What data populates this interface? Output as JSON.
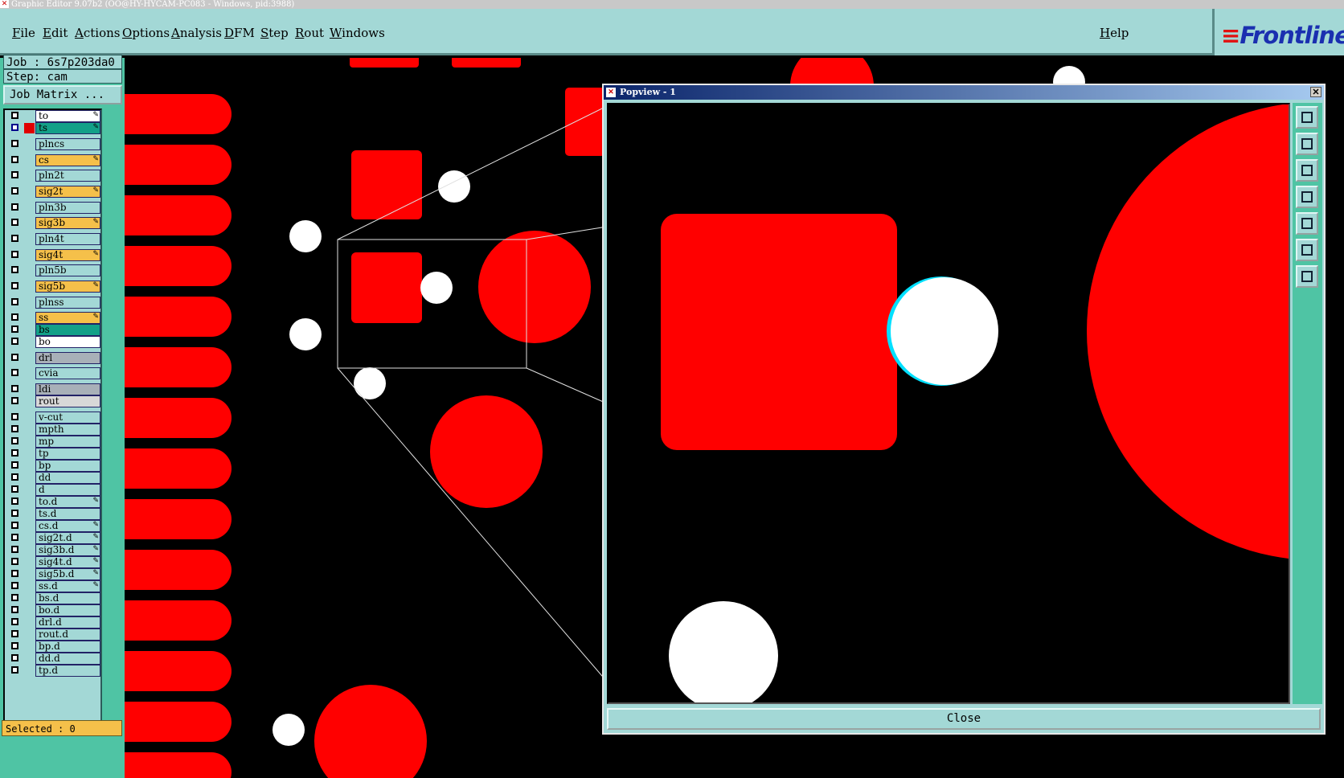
{
  "window": {
    "title": "Graphic Editor 9.07b2 (OO@HY-HYCAM-PC083 - Windows, pid:3988)"
  },
  "menu": [
    "File",
    "Edit",
    "Actions",
    "Options",
    "Analysis",
    "DFM",
    "Step",
    "Rout",
    "Windows"
  ],
  "help": "Help",
  "logo": {
    "text": "Frontline",
    "icon": "frontline-logo-icon"
  },
  "job": {
    "label": "Job : 6s7p203da0"
  },
  "step": {
    "label": "Step: cam"
  },
  "job_matrix": "Job Matrix ...",
  "layers": [
    {
      "name": "to",
      "color": "#ffffff",
      "edit": true
    },
    {
      "name": "ts",
      "color": "#13a088",
      "edit": true,
      "active": true
    },
    {
      "name": "plncs",
      "color": "#a3d8d6",
      "edit": false
    },
    {
      "name": "cs",
      "color": "#f5c04a",
      "edit": true
    },
    {
      "name": "pln2t",
      "color": "#a3d8d6",
      "edit": false
    },
    {
      "name": "sig2t",
      "color": "#f5c04a",
      "edit": true
    },
    {
      "name": "pln3b",
      "color": "#a3d8d6",
      "edit": false
    },
    {
      "name": "sig3b",
      "color": "#f5c04a",
      "edit": true
    },
    {
      "name": "pln4t",
      "color": "#a3d8d6",
      "edit": false
    },
    {
      "name": "sig4t",
      "color": "#f5c04a",
      "edit": true
    },
    {
      "name": "pln5b",
      "color": "#a3d8d6",
      "edit": false
    },
    {
      "name": "sig5b",
      "color": "#f5c04a",
      "edit": true
    },
    {
      "name": "plnss",
      "color": "#a3d8d6",
      "edit": false
    },
    {
      "name": "ss",
      "color": "#f5c04a",
      "edit": true
    },
    {
      "name": "bs",
      "color": "#13a088",
      "edit": false
    },
    {
      "name": "bo",
      "color": "#ffffff",
      "edit": false
    },
    {
      "name": "drl",
      "color": "#a8b0b8",
      "edit": false
    },
    {
      "name": "cvia",
      "color": "#a3d8d6",
      "edit": false
    },
    {
      "name": "ldi",
      "color": "#a8b0b8",
      "edit": false
    },
    {
      "name": "rout",
      "color": "#d8d8d8",
      "edit": false
    },
    {
      "name": "v-cut",
      "color": "#a3d8d6",
      "edit": false
    },
    {
      "name": "mpth",
      "color": "#a3d8d6",
      "edit": false
    },
    {
      "name": "mp",
      "color": "#a3d8d6",
      "edit": false
    },
    {
      "name": "tp",
      "color": "#a3d8d6",
      "edit": false
    },
    {
      "name": "bp",
      "color": "#a3d8d6",
      "edit": false
    },
    {
      "name": "dd",
      "color": "#a3d8d6",
      "edit": false
    },
    {
      "name": "d",
      "color": "#a3d8d6",
      "edit": false
    },
    {
      "name": "to.d",
      "color": "#a3d8d6",
      "edit": true
    },
    {
      "name": "ts.d",
      "color": "#a3d8d6",
      "edit": false
    },
    {
      "name": "cs.d",
      "color": "#a3d8d6",
      "edit": true
    },
    {
      "name": "sig2t.d",
      "color": "#a3d8d6",
      "edit": true
    },
    {
      "name": "sig3b.d",
      "color": "#a3d8d6",
      "edit": true
    },
    {
      "name": "sig4t.d",
      "color": "#a3d8d6",
      "edit": true
    },
    {
      "name": "sig5b.d",
      "color": "#a3d8d6",
      "edit": true
    },
    {
      "name": "ss.d",
      "color": "#a3d8d6",
      "edit": true
    },
    {
      "name": "bs.d",
      "color": "#a3d8d6",
      "edit": false
    },
    {
      "name": "bo.d",
      "color": "#a3d8d6",
      "edit": false
    },
    {
      "name": "drl.d",
      "color": "#a3d8d6",
      "edit": false
    },
    {
      "name": "rout.d",
      "color": "#a3d8d6",
      "edit": false
    },
    {
      "name": "bp.d",
      "color": "#a3d8d6",
      "edit": false
    },
    {
      "name": "dd.d",
      "color": "#a3d8d6",
      "edit": false
    },
    {
      "name": "tp.d",
      "color": "#a3d8d6",
      "edit": false
    }
  ],
  "selected": "Selected : 0",
  "popview": {
    "title": "Popview - 1",
    "close": "Close",
    "close_x": "✕",
    "tools": [
      "zoom-fit-icon",
      "pan-up-icon",
      "pan-down-icon",
      "pan-left-icon",
      "pan-right-icon",
      "zoom-out-icon",
      "zoom-in-icon"
    ]
  },
  "colors": {
    "pad": "#ff0000",
    "hole": "#ffffff",
    "menu": "#a3d8d6",
    "panel": "#4fc4a4",
    "highlight": "#f5c04a"
  }
}
